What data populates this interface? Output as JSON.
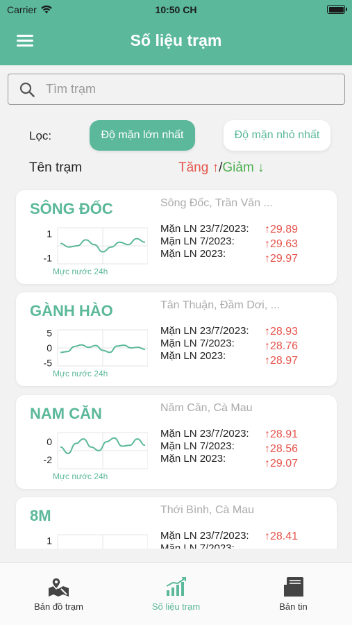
{
  "status_bar": {
    "carrier": "Carrier",
    "time": "10:50 CH"
  },
  "header": {
    "title": "Số liệu trạm"
  },
  "search": {
    "placeholder": "Tìm trạm"
  },
  "filter": {
    "label": "Lọc:",
    "active": "Độ mặn lớn nhất",
    "inactive": "Độ mặn nhỏ nhất"
  },
  "list_header": {
    "name_col": "Tên trạm",
    "sort_up": "Tăng ↑",
    "sort_sep": "/",
    "sort_down": "Giảm ↓"
  },
  "stations": [
    {
      "name": "SÔNG ĐỐC",
      "location": "Sông Đốc, Trần Văn ...",
      "chart_caption": "Mực nước 24h",
      "ticks": [
        "1",
        "-1"
      ],
      "tick_values": [
        1,
        -1
      ],
      "range": [
        -1.5,
        1.5
      ],
      "series": [
        0.2,
        -0.1,
        0.0,
        0.5,
        0.1,
        -0.5,
        -0.1,
        0.3,
        0.1,
        0.6,
        0.3
      ],
      "metrics": [
        {
          "label": "Mặn LN 23/7/2023:",
          "value": "↑29.89"
        },
        {
          "label": "Mặn LN 7/2023:",
          "value": "↑29.63"
        },
        {
          "label": "Mặn LN 2023:",
          "value": "↑29.97"
        }
      ]
    },
    {
      "name": "GÀNH HÀO",
      "location": "Tân Thuận, Đầm Dơi, ...",
      "chart_caption": "Mực nước 24h",
      "ticks": [
        "5",
        "0",
        "-5"
      ],
      "tick_values": [
        5,
        0,
        -5
      ],
      "range": [
        -6,
        6
      ],
      "series": [
        -1.5,
        -1.2,
        0.5,
        1.0,
        0.2,
        0.8,
        -0.8,
        -1.5,
        0.6,
        0.9,
        0.0,
        0.2,
        -0.5
      ],
      "metrics": [
        {
          "label": "Mặn LN 23/7/2023:",
          "value": "↑28.93"
        },
        {
          "label": "Mặn LN 7/2023:",
          "value": "↑28.76"
        },
        {
          "label": "Mặn LN 2023:",
          "value": "↑28.97"
        }
      ]
    },
    {
      "name": "NAM CĂN",
      "location": "Năm Căn, Cà Mau",
      "chart_caption": "Mực nước 24h",
      "ticks": [
        "0",
        "-2"
      ],
      "tick_values": [
        0,
        -2
      ],
      "range": [
        -3,
        1
      ],
      "series": [
        -0.6,
        -1.3,
        -0.2,
        0.3,
        -0.6,
        -1.0,
        0.0,
        0.4,
        -0.5,
        -0.4,
        0.3,
        -0.4
      ],
      "metrics": [
        {
          "label": "Mặn LN 23/7/2023:",
          "value": "↑28.91"
        },
        {
          "label": "Mặn LN 7/2023:",
          "value": "↑28.56"
        },
        {
          "label": "Mặn LN 2023:",
          "value": "↑29.07"
        }
      ]
    },
    {
      "name": "8M",
      "location": "Thới Bình, Cà Mau",
      "chart_caption": "",
      "ticks": [
        "1"
      ],
      "tick_values": [
        1
      ],
      "range": [
        -1.5,
        1.5
      ],
      "series": [],
      "metrics": [
        {
          "label": "Mặn LN 23/7/2023:",
          "value": "↑28.41"
        },
        {
          "label": "Mặn LN 7/2023:",
          "value": ""
        }
      ]
    }
  ],
  "tabs": [
    {
      "label": "Bản đồ trạm",
      "icon": "map-pin-icon"
    },
    {
      "label": "Số liệu trạm",
      "icon": "signal-bars-icon"
    },
    {
      "label": "Bản tin",
      "icon": "newspaper-icon"
    }
  ],
  "colors": {
    "primary": "#5bb89a",
    "increase": "#e5534b",
    "decrease": "#4caf50"
  }
}
